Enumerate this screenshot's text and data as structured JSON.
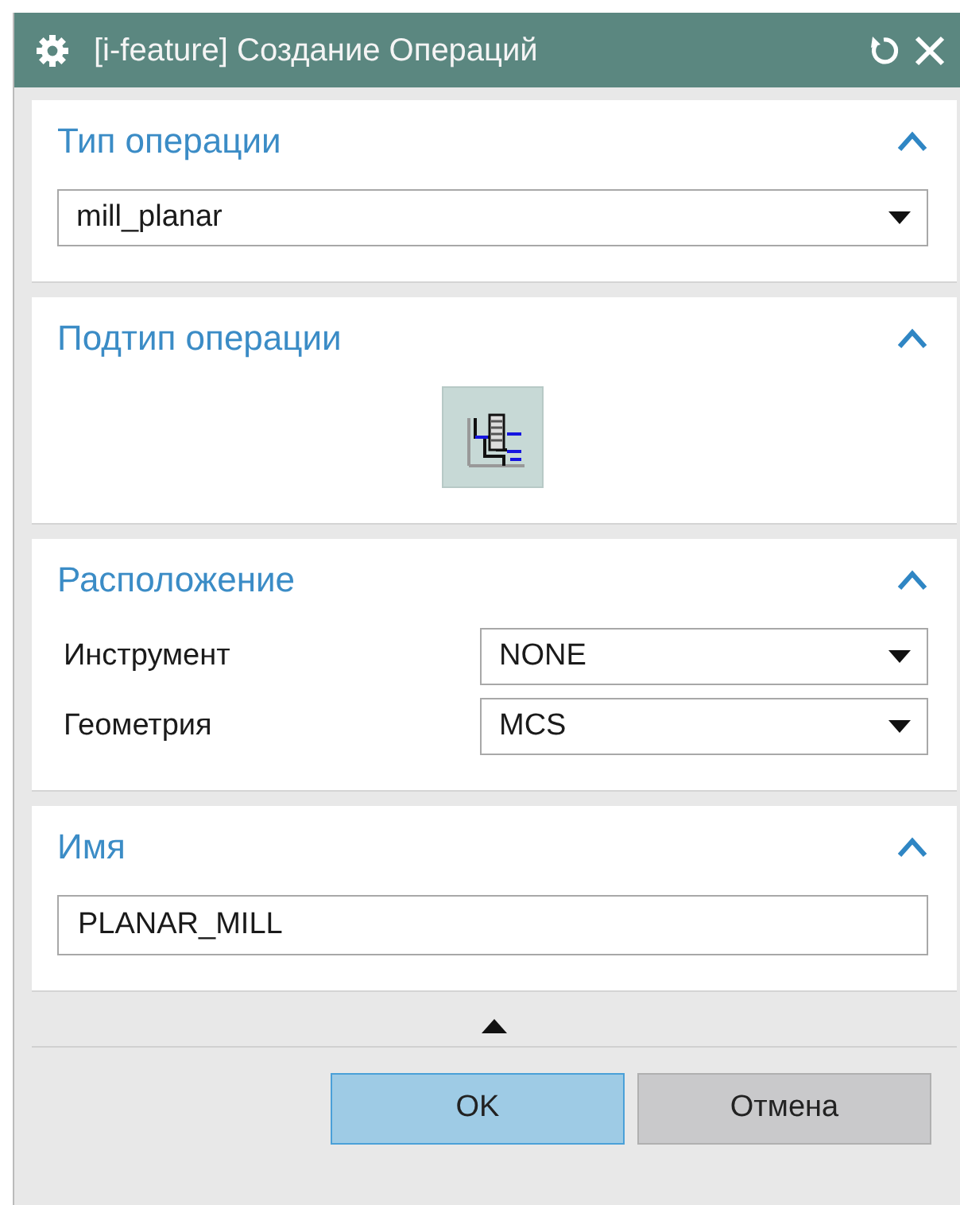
{
  "window": {
    "title": "[i-feature] Создание Операций"
  },
  "sections": [
    {
      "title": "Тип операции",
      "expanded": true,
      "kind": "dropdown",
      "value": "mill_planar"
    },
    {
      "title": "Подтип операции",
      "expanded": true,
      "kind": "subtypes",
      "items": [
        {
          "selected": true
        }
      ]
    },
    {
      "title": "Расположение",
      "expanded": true,
      "kind": "fields",
      "fields": [
        {
          "label": "Инструмент",
          "value": "NONE"
        },
        {
          "label": "Геометрия",
          "value": "MCS"
        }
      ]
    },
    {
      "title": "Имя",
      "expanded": true,
      "kind": "text",
      "value": "PLANAR_MILL"
    }
  ],
  "buttons": [
    {
      "label": "OK",
      "default": true
    },
    {
      "label": "Отмена",
      "default": false
    }
  ]
}
